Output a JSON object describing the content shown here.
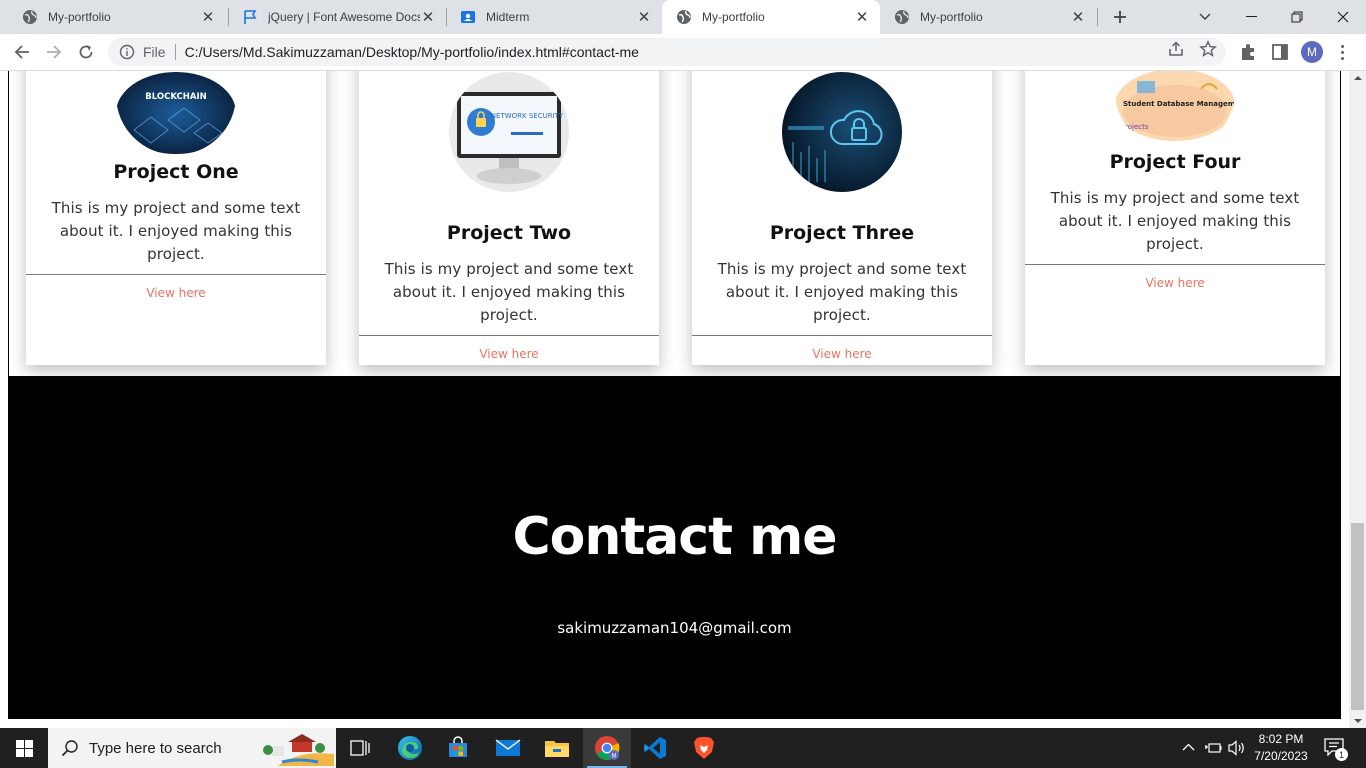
{
  "browser": {
    "tabs": [
      {
        "title": "My-portfolio",
        "icon": "globe-icon",
        "active": false
      },
      {
        "title": "jQuery | Font Awesome Docs",
        "icon": "flag-icon",
        "active": false
      },
      {
        "title": "Midterm",
        "icon": "classroom-icon",
        "active": false
      },
      {
        "title": "My-portfolio",
        "icon": "globe-icon",
        "active": true
      },
      {
        "title": "My-portfolio",
        "icon": "globe-icon",
        "active": false
      }
    ],
    "omnibox": {
      "scheme_label": "File",
      "url": "C:/Users/Md.Sakimuzzaman/Desktop/My-portfolio/index.html#contact-me"
    },
    "profile_initial": "M"
  },
  "page": {
    "projects": [
      {
        "title": "Project One",
        "text": "This is my project and some text about it. I enjoyed making this project.",
        "link": "View here",
        "image": "blockchain-thumbnail",
        "image_caption": "BLOCKCHAIN"
      },
      {
        "title": "Project Two",
        "text": "This is my project and some text about it. I enjoyed making this project.",
        "link": "View here",
        "image": "network-security-thumbnail",
        "image_caption": "NETWORK SECURITY"
      },
      {
        "title": "Project Three",
        "text": "This is my project and some text about it. I enjoyed making this project.",
        "link": "View here",
        "image": "cloud-security-thumbnail"
      },
      {
        "title": "Project Four",
        "text": "This is my project and some text about it. I enjoyed making this project.",
        "link": "View here",
        "image": "student-database-thumbnail",
        "image_caption": "Student Database Management System",
        "image_caption_sub": "rojects"
      }
    ],
    "contact": {
      "title": "Contact me",
      "email": "sakimuzzaman104@gmail.com"
    },
    "colors": {
      "link": "#e8735f",
      "contact_bg": "#000000"
    }
  },
  "taskbar": {
    "search_placeholder": "Type here to search",
    "apps": [
      "task-view-icon",
      "edge-icon",
      "store-icon",
      "mail-icon",
      "file-explorer-icon",
      "chrome-icon",
      "vscode-icon",
      "brave-icon"
    ],
    "time": "8:02 PM",
    "date": "7/20/2023",
    "notification_count": "1"
  }
}
